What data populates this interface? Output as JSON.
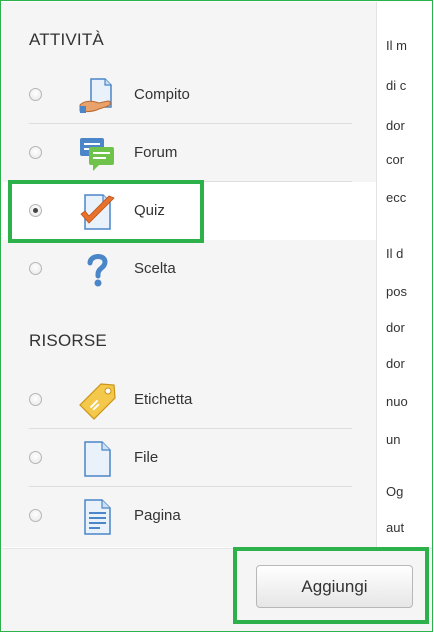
{
  "sections": {
    "activities_title": "ATTIVITÀ",
    "resources_title": "RISORSE"
  },
  "activities": [
    {
      "label": "Compito",
      "icon": "assignment-icon",
      "selected": false
    },
    {
      "label": "Forum",
      "icon": "forum-icon",
      "selected": false
    },
    {
      "label": "Quiz",
      "icon": "quiz-icon",
      "selected": true
    },
    {
      "label": "Scelta",
      "icon": "choice-icon",
      "selected": false
    }
  ],
  "resources": [
    {
      "label": "Etichetta",
      "icon": "label-icon",
      "selected": false
    },
    {
      "label": "File",
      "icon": "file-icon",
      "selected": false
    },
    {
      "label": "Pagina",
      "icon": "page-icon",
      "selected": false
    }
  ],
  "description_lines": [
    "Il m",
    "di c",
    "dor",
    "cor",
    "ecc",
    "Il d",
    "pos",
    "dor",
    "dor",
    "nuo",
    "un",
    "Og",
    "aut"
  ],
  "footer": {
    "add_label": "Aggiungi"
  },
  "colors": {
    "highlight": "#2db14b",
    "sidebar_bg": "#f5f5f5"
  }
}
